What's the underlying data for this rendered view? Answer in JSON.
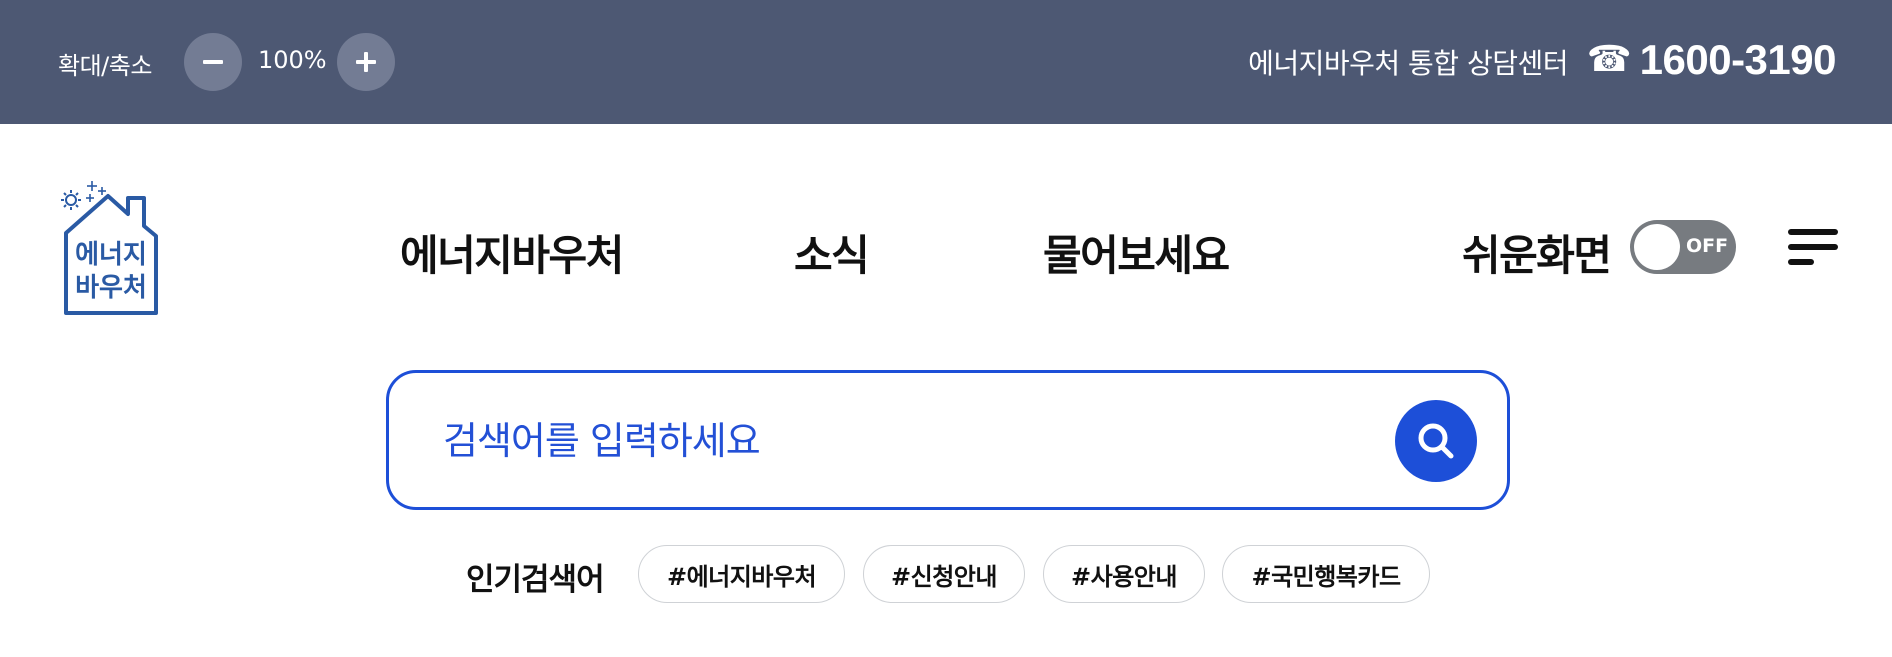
{
  "topbar": {
    "zoom_label": "확대/축소",
    "zoom_value": "100%",
    "helpdesk_label": "에너지바우처 통합 상담센터",
    "phone_icon": "☎",
    "phone_number": "1600-3190"
  },
  "logo": {
    "line1": "에너지",
    "line2": "바우처"
  },
  "nav": {
    "items": [
      {
        "label": "에너지바우처"
      },
      {
        "label": "소식"
      },
      {
        "label": "물어보세요"
      }
    ],
    "easy_mode_label": "쉬운화면",
    "easy_mode_state": "OFF"
  },
  "search": {
    "placeholder": "검색어를 입력하세요"
  },
  "popular": {
    "label": "인기검색어",
    "tags": [
      {
        "label": "#에너지바우처"
      },
      {
        "label": "#신청안내"
      },
      {
        "label": "#사용안내"
      },
      {
        "label": "#국민행복카드"
      }
    ]
  },
  "colors": {
    "topbar_bg": "#4d5873",
    "zoom_button_bg": "#737c94",
    "accent": "#1d4fd8",
    "toggle_off": "#777b80"
  },
  "icons": [
    "minus-icon",
    "plus-icon",
    "phone-icon",
    "search-icon",
    "menu-icon",
    "sun-icon",
    "snowflake-icon",
    "house-icon"
  ]
}
